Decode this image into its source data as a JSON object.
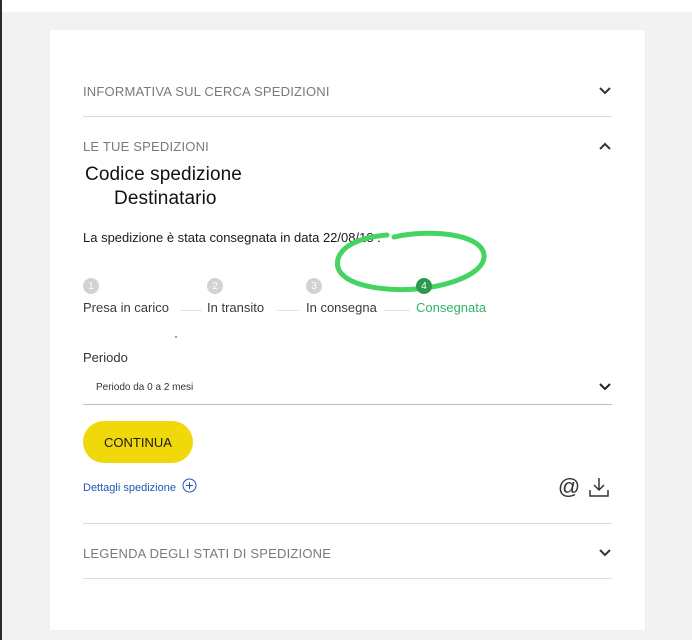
{
  "accordion": {
    "informativa": {
      "title": "INFORMATIVA SUL CERCA SPEDIZIONI",
      "icon": "chevron-down-icon"
    },
    "spedizioni": {
      "title": "LE TUE SPEDIZIONI",
      "icon": "chevron-up-icon"
    },
    "legenda": {
      "title": "LEGENDA DEGLI STATI DI SPEDIZIONE",
      "icon": "chevron-down-icon"
    }
  },
  "overlay": {
    "codice_label": "Codice spedizione",
    "destinatario_label": "Destinatario"
  },
  "shipment": {
    "status_message": "La spedizione è stata consegnata in data 22/08/18 ."
  },
  "steps": [
    {
      "number": "1",
      "label": "Presa in carico",
      "active": false
    },
    {
      "number": "2",
      "label": "In transito",
      "active": false
    },
    {
      "number": "3",
      "label": "In consegna",
      "active": false
    },
    {
      "number": "4",
      "label": "Consegnata",
      "active": true
    }
  ],
  "periodo": {
    "label": "Periodo",
    "selected": "Periodo da 0 a 2 mesi"
  },
  "actions": {
    "continua_label": "CONTINUA",
    "dettagli_label": "Dettagli spedizione",
    "email_icon": "at-icon",
    "download_icon": "download-icon"
  },
  "colors": {
    "accent_yellow": "#f0d80b",
    "step_active": "#2b9a4c",
    "step_active_label": "#33b266",
    "link_blue": "#1e59b3",
    "annotation_green": "#44d462"
  }
}
